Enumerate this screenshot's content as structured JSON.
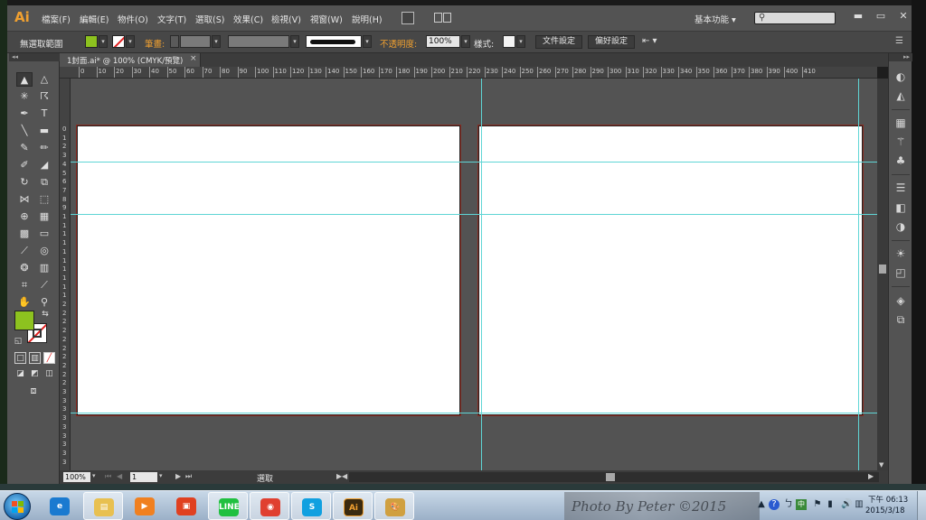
{
  "app": {
    "logo": "Ai",
    "menus": [
      "檔案(F)",
      "編輯(E)",
      "物件(O)",
      "文字(T)",
      "選取(S)",
      "效果(C)",
      "檢視(V)",
      "視窗(W)",
      "說明(H)"
    ],
    "workspace": "基本功能 ▾",
    "window_buttons": {
      "minimize": "▬",
      "maximize": "▭",
      "close": "✕"
    }
  },
  "control_bar": {
    "no_selection": "無選取範圍",
    "stroke_label": "筆畫:",
    "opacity_label": "不透明度:",
    "opacity_value": "100%",
    "style_label": "樣式:",
    "doc_setup_button": "文件設定",
    "prefs_button": "偏好設定",
    "colors": {
      "fill": "#8dc21f",
      "accent": "#f0a030"
    }
  },
  "document": {
    "tab_label": "1封面.ai* @ 100% (CMYK/預覽)",
    "tab_close": "×",
    "ruler_h": [
      "0",
      "10",
      "20",
      "30",
      "40",
      "50",
      "60",
      "70",
      "80",
      "90",
      "100",
      "110",
      "120",
      "130",
      "140",
      "150",
      "160",
      "170",
      "180",
      "190",
      "200",
      "210",
      "220",
      "230",
      "240",
      "250",
      "260",
      "270",
      "280",
      "290",
      "300",
      "310",
      "320",
      "330",
      "340",
      "350",
      "360",
      "370",
      "380",
      "390",
      "400",
      "410"
    ],
    "ruler_v": [
      "0",
      "1",
      "2",
      "3",
      "4",
      "5",
      "6",
      "7",
      "8",
      "9",
      "1",
      "1",
      "1",
      "1",
      "1",
      "1",
      "1",
      "1",
      "1",
      "1",
      "2",
      "2",
      "2",
      "2",
      "2",
      "2",
      "2",
      "2",
      "2",
      "2",
      "3",
      "3",
      "3",
      "3",
      "3",
      "3",
      "3",
      "3",
      "3",
      "3",
      "4",
      "4",
      "4",
      "4",
      "4"
    ]
  },
  "status_bar": {
    "zoom": "100%",
    "page": "1",
    "status": "選取"
  },
  "tools": {
    "items": [
      {
        "name": "selection-tool",
        "glyph": "▲",
        "active": true
      },
      {
        "name": "direct-selection-tool",
        "glyph": "△"
      },
      {
        "name": "magic-wand-tool",
        "glyph": "✳"
      },
      {
        "name": "lasso-tool",
        "glyph": "☈"
      },
      {
        "name": "pen-tool",
        "glyph": "✒"
      },
      {
        "name": "type-tool",
        "glyph": "T"
      },
      {
        "name": "line-tool",
        "glyph": "╲"
      },
      {
        "name": "rectangle-tool",
        "glyph": "▬"
      },
      {
        "name": "paintbrush-tool",
        "glyph": "✎"
      },
      {
        "name": "pencil-tool",
        "glyph": "✏"
      },
      {
        "name": "blob-brush-tool",
        "glyph": "✐"
      },
      {
        "name": "eraser-tool",
        "glyph": "◢"
      },
      {
        "name": "rotate-tool",
        "glyph": "↻"
      },
      {
        "name": "scale-tool",
        "glyph": "⧉"
      },
      {
        "name": "width-tool",
        "glyph": "⋈"
      },
      {
        "name": "free-transform-tool",
        "glyph": "⬚"
      },
      {
        "name": "shape-builder-tool",
        "glyph": "⊕"
      },
      {
        "name": "perspective-grid-tool",
        "glyph": "▦"
      },
      {
        "name": "mesh-tool",
        "glyph": "▩"
      },
      {
        "name": "gradient-tool",
        "glyph": "▭"
      },
      {
        "name": "eyedropper-tool",
        "glyph": "⟋"
      },
      {
        "name": "blend-tool",
        "glyph": "◎"
      },
      {
        "name": "symbol-sprayer-tool",
        "glyph": "❂"
      },
      {
        "name": "column-graph-tool",
        "glyph": "▥"
      },
      {
        "name": "artboard-tool",
        "glyph": "⌗"
      },
      {
        "name": "slice-tool",
        "glyph": "⟋"
      },
      {
        "name": "hand-tool",
        "glyph": "✋"
      },
      {
        "name": "zoom-tool",
        "glyph": "⚲"
      }
    ],
    "swap_icon": "⇆",
    "default_icon": "◱"
  },
  "dock_icons": [
    "color-icon",
    "color-guide-icon",
    "swatches-icon",
    "brushes-icon",
    "symbols-icon",
    "stroke-icon",
    "gradient-icon",
    "transparency-icon",
    "appearance-icon",
    "graphic-styles-icon",
    "layers-icon",
    "artboards-icon"
  ],
  "taskbar": {
    "apps": [
      {
        "name": "ie-icon",
        "label": "e",
        "color": "#1a7ad0",
        "open": false
      },
      {
        "name": "explorer-icon",
        "label": "▤",
        "color": "#e8c050",
        "open": true
      },
      {
        "name": "media-player-icon",
        "label": "▶",
        "color": "#f08020",
        "open": false
      },
      {
        "name": "pictures-icon",
        "label": "▣",
        "color": "#e04020",
        "open": false
      },
      {
        "name": "line-app-icon",
        "label": "LINE",
        "color": "#20c040",
        "open": true
      },
      {
        "name": "chrome-icon",
        "label": "◉",
        "color": "#e04030",
        "open": true
      },
      {
        "name": "skype-icon",
        "label": "S",
        "color": "#10a0e0",
        "open": true
      },
      {
        "name": "illustrator-icon",
        "label": "Ai",
        "color": "#3a2a10",
        "open": true
      },
      {
        "name": "paint-icon",
        "label": "🎨",
        "color": "#d0a040",
        "open": true
      }
    ],
    "photo_credit": "Photo By Peter  ©2015",
    "clock_time": "下午 06:13",
    "clock_date": "2015/3/18"
  }
}
